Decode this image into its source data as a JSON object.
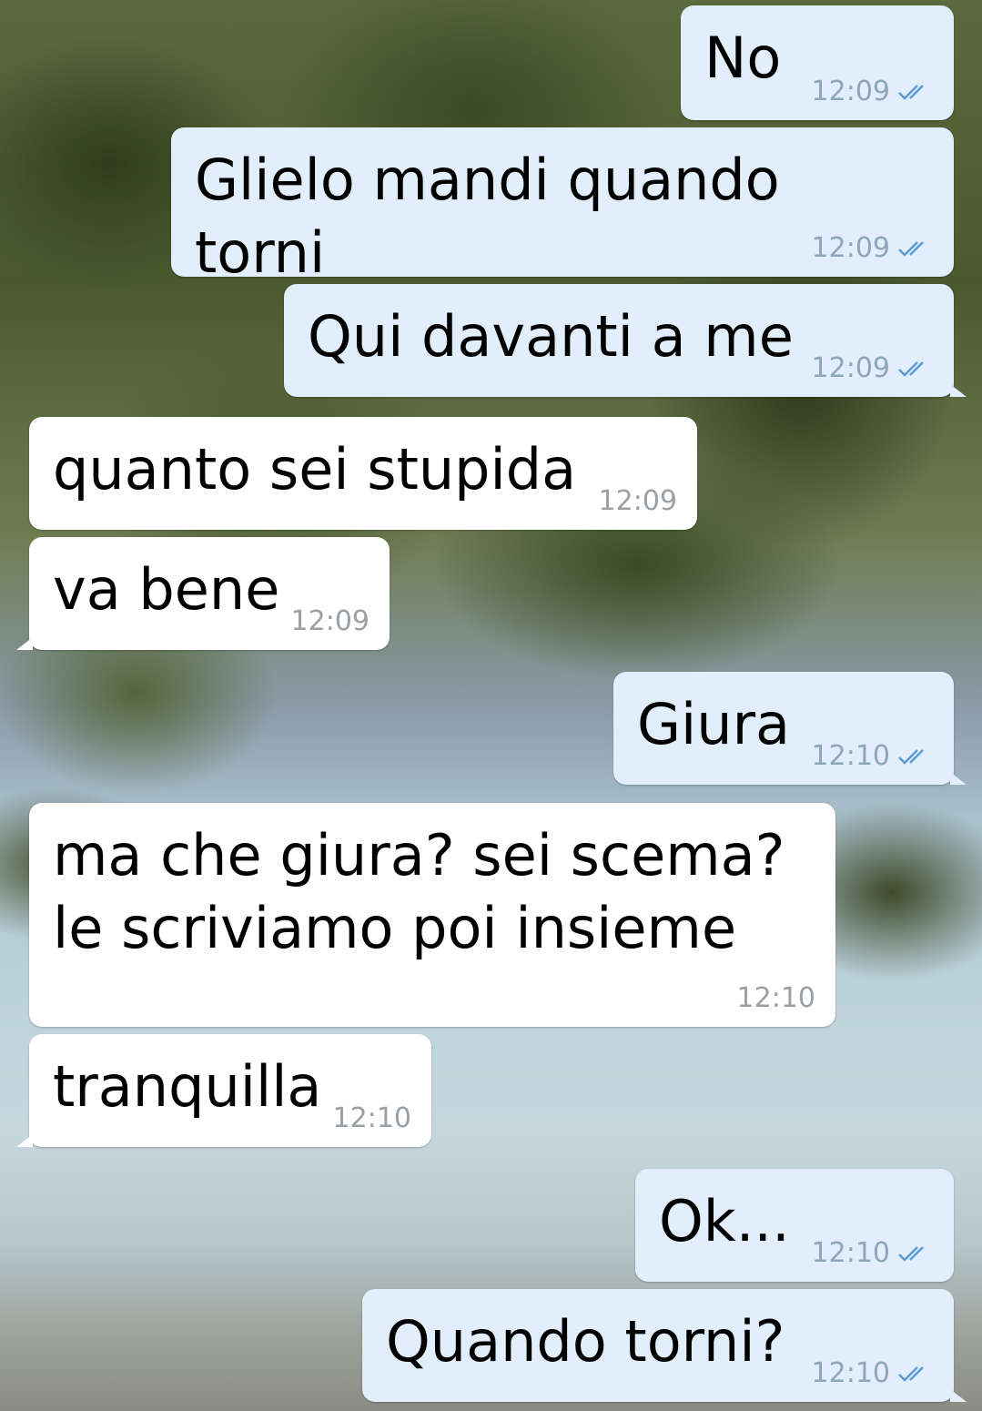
{
  "messages": [
    {
      "id": "m1",
      "dir": "out",
      "text": "No",
      "time": "12:09",
      "read": true
    },
    {
      "id": "m2",
      "dir": "out",
      "text": "Glielo mandi quando torni",
      "time": "12:09",
      "read": true
    },
    {
      "id": "m3",
      "dir": "out",
      "text": "Qui davanti a me",
      "time": "12:09",
      "read": true
    },
    {
      "id": "m4",
      "dir": "in",
      "text": "quanto sei stupida",
      "time": "12:09"
    },
    {
      "id": "m5",
      "dir": "in",
      "text": "va bene",
      "time": "12:09"
    },
    {
      "id": "m6",
      "dir": "out",
      "text": "Giura",
      "time": "12:10",
      "read": true
    },
    {
      "id": "m7",
      "dir": "in",
      "text": "ma che giura? sei scema?\nle scriviamo poi insieme",
      "time": "12:10"
    },
    {
      "id": "m8",
      "dir": "in",
      "text": "tranquilla",
      "time": "12:10"
    },
    {
      "id": "m9",
      "dir": "out",
      "text": "Ok...",
      "time": "12:10",
      "read": true
    },
    {
      "id": "m10",
      "dir": "out",
      "text": "Quando torni?",
      "time": "12:10",
      "read": true
    }
  ],
  "colors": {
    "outgoing_bubble": "#e2eefb",
    "incoming_bubble": "#ffffff",
    "read_ticks": "#5b9bd5"
  },
  "icons": {
    "read_receipt": "double-check-icon"
  }
}
